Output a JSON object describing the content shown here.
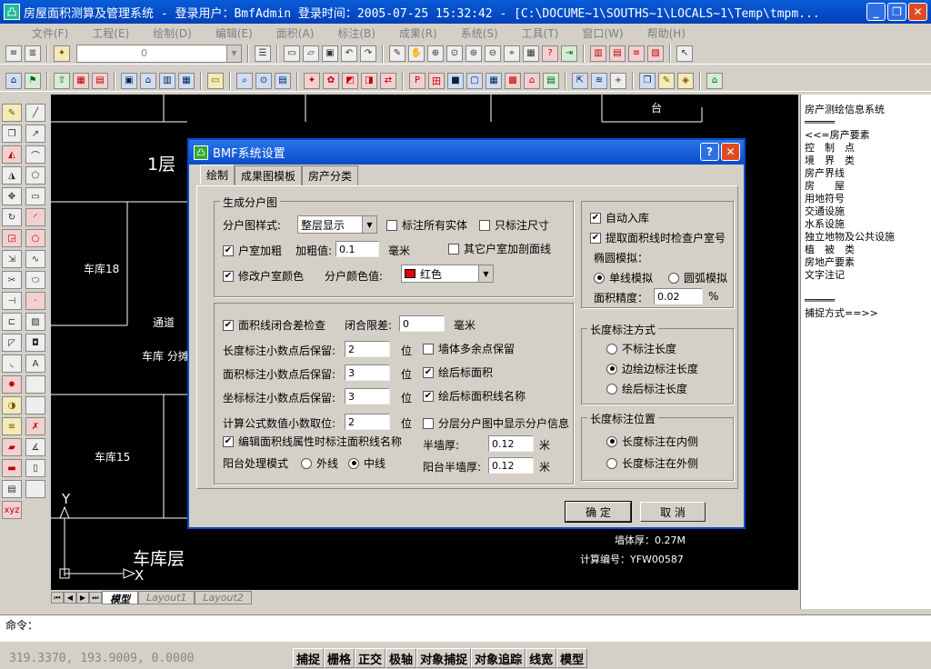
{
  "window": {
    "title": "房屋面积测算及管理系统 - 登录用户：BmfAdmin   登录时间：2005-07-25 15:32:42 - [C:\\DOCUME~1\\SOUTHS~1\\LOCALS~1\\Temp\\tmpm...",
    "app_icon": "cad-app-icon",
    "min": "_",
    "max": "❐",
    "close": "✕"
  },
  "menu": [
    "文件(F)",
    "工程(E)",
    "绘制(D)",
    "编辑(E)",
    "面积(A)",
    "标注(B)",
    "成果(R)",
    "系统(S)",
    "工具(T)",
    "窗口(W)",
    "帮助(H)"
  ],
  "toolbar": {
    "layer_value": "0"
  },
  "canvas": {
    "texts": {
      "floor1": "1层",
      "garage18": "车库18",
      "corridor": "通道",
      "garage_split": "车库 分摊",
      "garage15": "车库15",
      "garage_layer": "车库层",
      "axis_y": "Y",
      "axis_x": "X",
      "tai": "台",
      "wall_thickness": "墙体厚：0.27M",
      "calc_number": "计算编号：YFW00587"
    }
  },
  "layout_tabs": [
    "模型",
    "Layout1",
    "Layout2"
  ],
  "right_panel": [
    "房产测绘信息系统",
    "═════",
    "<<=房产要素",
    "控　制　点",
    "境　界　类",
    "房产界线",
    "房　　屋",
    "用地符号",
    "交通设施",
    "水系设施",
    "独立地物及公共设施",
    "植　被　类",
    "房地产要素",
    "文字注记",
    "",
    "═════",
    "捕捉方式==>>"
  ],
  "command": {
    "label": "命令："
  },
  "status": {
    "coords": "319.3370, 193.9009, 0.0000",
    "buttons": [
      "捕捉",
      "栅格",
      "正交",
      "极轴",
      "对象捕捉",
      "对象追踪",
      "线宽",
      "模型"
    ]
  },
  "dialog": {
    "title": "BMF系统设置",
    "help": "?",
    "close": "✕",
    "tabs": [
      "绘制",
      "成果图模板",
      "房产分类"
    ],
    "group1": {
      "title": "生成分户图",
      "style_label": "分户图样式:",
      "style_value": "整层显示",
      "mark_all": "标注所有实体",
      "mark_size": "只标注尺寸",
      "bold_room": "户室加粗",
      "bold_value_label": "加粗值:",
      "bold_value": "0.1",
      "bold_unit": "毫米",
      "other_bold": "其它户室加剖面线",
      "change_color": "修改户室颜色",
      "color_label": "分户颜色值:",
      "color_value": "红色",
      "color_hex": "#e00000"
    },
    "group2": {
      "closure_check": "面积线闭合差检查",
      "closure_label": "闭合限差:",
      "closure_value": "0",
      "closure_unit": "毫米",
      "len_dec_label": "长度标注小数点后保留:",
      "len_dec": "2",
      "area_dec_label": "面积标注小数点后保留:",
      "area_dec": "3",
      "coord_dec_label": "坐标标注小数点后保留:",
      "coord_dec": "3",
      "formula_dec_label": "计算公式数值小数取位:",
      "formula_dec": "2",
      "unit_wei": "位",
      "wall_multi": "墙体多余点保留",
      "draw_area": "绘后标面积",
      "draw_area_name": "绘后标面积线名称",
      "layer_info": "分层分户图中显示分户信息",
      "edit_attr": "编辑面积线属性时标注面积线名称",
      "balcony_label": "阳台处理模式",
      "balcony_outer": "外线",
      "balcony_center": "中线",
      "half_wall_label": "半墙厚:",
      "half_wall": "0.12",
      "balcony_half_label": "阳台半墙厚:",
      "balcony_half": "0.12",
      "unit_m": "米"
    },
    "right": {
      "auto_store": "自动入库",
      "check_room": "提取面积线时检查户室号",
      "ellipse_label": "椭圆模拟：",
      "single_line": "单线模拟",
      "arc_sim": "圆弧模拟",
      "precision_label": "面积精度：",
      "precision": "0.02",
      "precision_unit": "%"
    },
    "length_mode": {
      "title": "长度标注方式",
      "options": [
        "不标注长度",
        "边绘边标注长度",
        "绘后标注长度"
      ]
    },
    "length_pos": {
      "title": "长度标注位置",
      "options": [
        "长度标注在内侧",
        "长度标注在外侧"
      ]
    },
    "ok": "确 定",
    "cancel": "取 消"
  }
}
